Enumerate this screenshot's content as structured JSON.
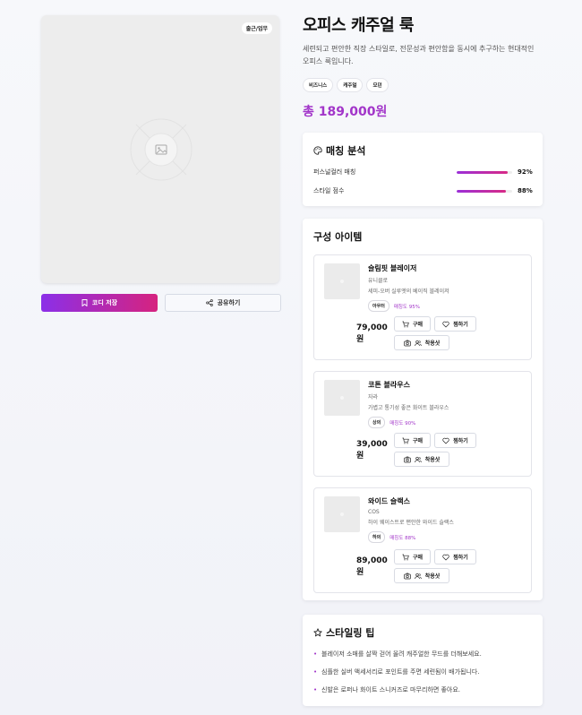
{
  "colors": {
    "accent": "#a235c9",
    "gradient_start": "#8b2fe8",
    "gradient_end": "#d6237f",
    "background": "#f4f5f9"
  },
  "product_image": {
    "tag": "출근/업무",
    "icon": "image-icon"
  },
  "buttons": {
    "save_label": "코디 저장",
    "save_icon": "bookmark-icon",
    "share_label": "공유하기",
    "share_icon": "share-icon"
  },
  "outfit": {
    "title": "오피스 캐주얼 룩",
    "description": "세련되고 편안한 직장 스타일로, 전문성과 편안함을 동시에 추구하는 현대적인 오피스 룩입니다.",
    "tags": [
      "비즈니스",
      "캐주얼",
      "모던"
    ],
    "price": "총 189,000원"
  },
  "match_analysis": {
    "title": "매칭 분석",
    "icon": "palette-icon",
    "metrics": [
      {
        "label": "퍼스널컬러 매칭",
        "value": "92%",
        "fraction": 0.92
      },
      {
        "label": "스타일 점수",
        "value": "88%",
        "fraction": 0.88
      }
    ]
  },
  "items_section": {
    "title": "구성 아이템",
    "buy_label": "구매",
    "wish_label": "찜하기",
    "try_label": "착용샷",
    "items": [
      {
        "name": "슬림핏 블레이저",
        "brand": "유니클로",
        "desc": "세미-오버 실루엣의 베이직 블레이저",
        "category": "아우터",
        "match": "매칭도 95%",
        "price": "79,000원"
      },
      {
        "name": "코튼 블라우스",
        "brand": "자라",
        "desc": "가볍고 통기성 좋은 화이트 블라우스",
        "category": "상의",
        "match": "매칭도 90%",
        "price": "39,000원"
      },
      {
        "name": "와이드 슬랙스",
        "brand": "COS",
        "desc": "하이 웨이스트로 편안한 와이드 슬랙스",
        "category": "하의",
        "match": "매칭도 88%",
        "price": "89,000원"
      }
    ]
  },
  "styling_tips": {
    "title": "스타일링 팁",
    "icon": "star-icon",
    "tips": [
      "블레이저 소매를 살짝 걷어 올려 캐주얼한 무드를 더해보세요.",
      "심플한 실버 액세서리로 포인트를 주면 세련됨이 배가됩니다.",
      "신발은 로퍼나 화이트 스니커즈로 마무리하면 좋아요."
    ]
  }
}
